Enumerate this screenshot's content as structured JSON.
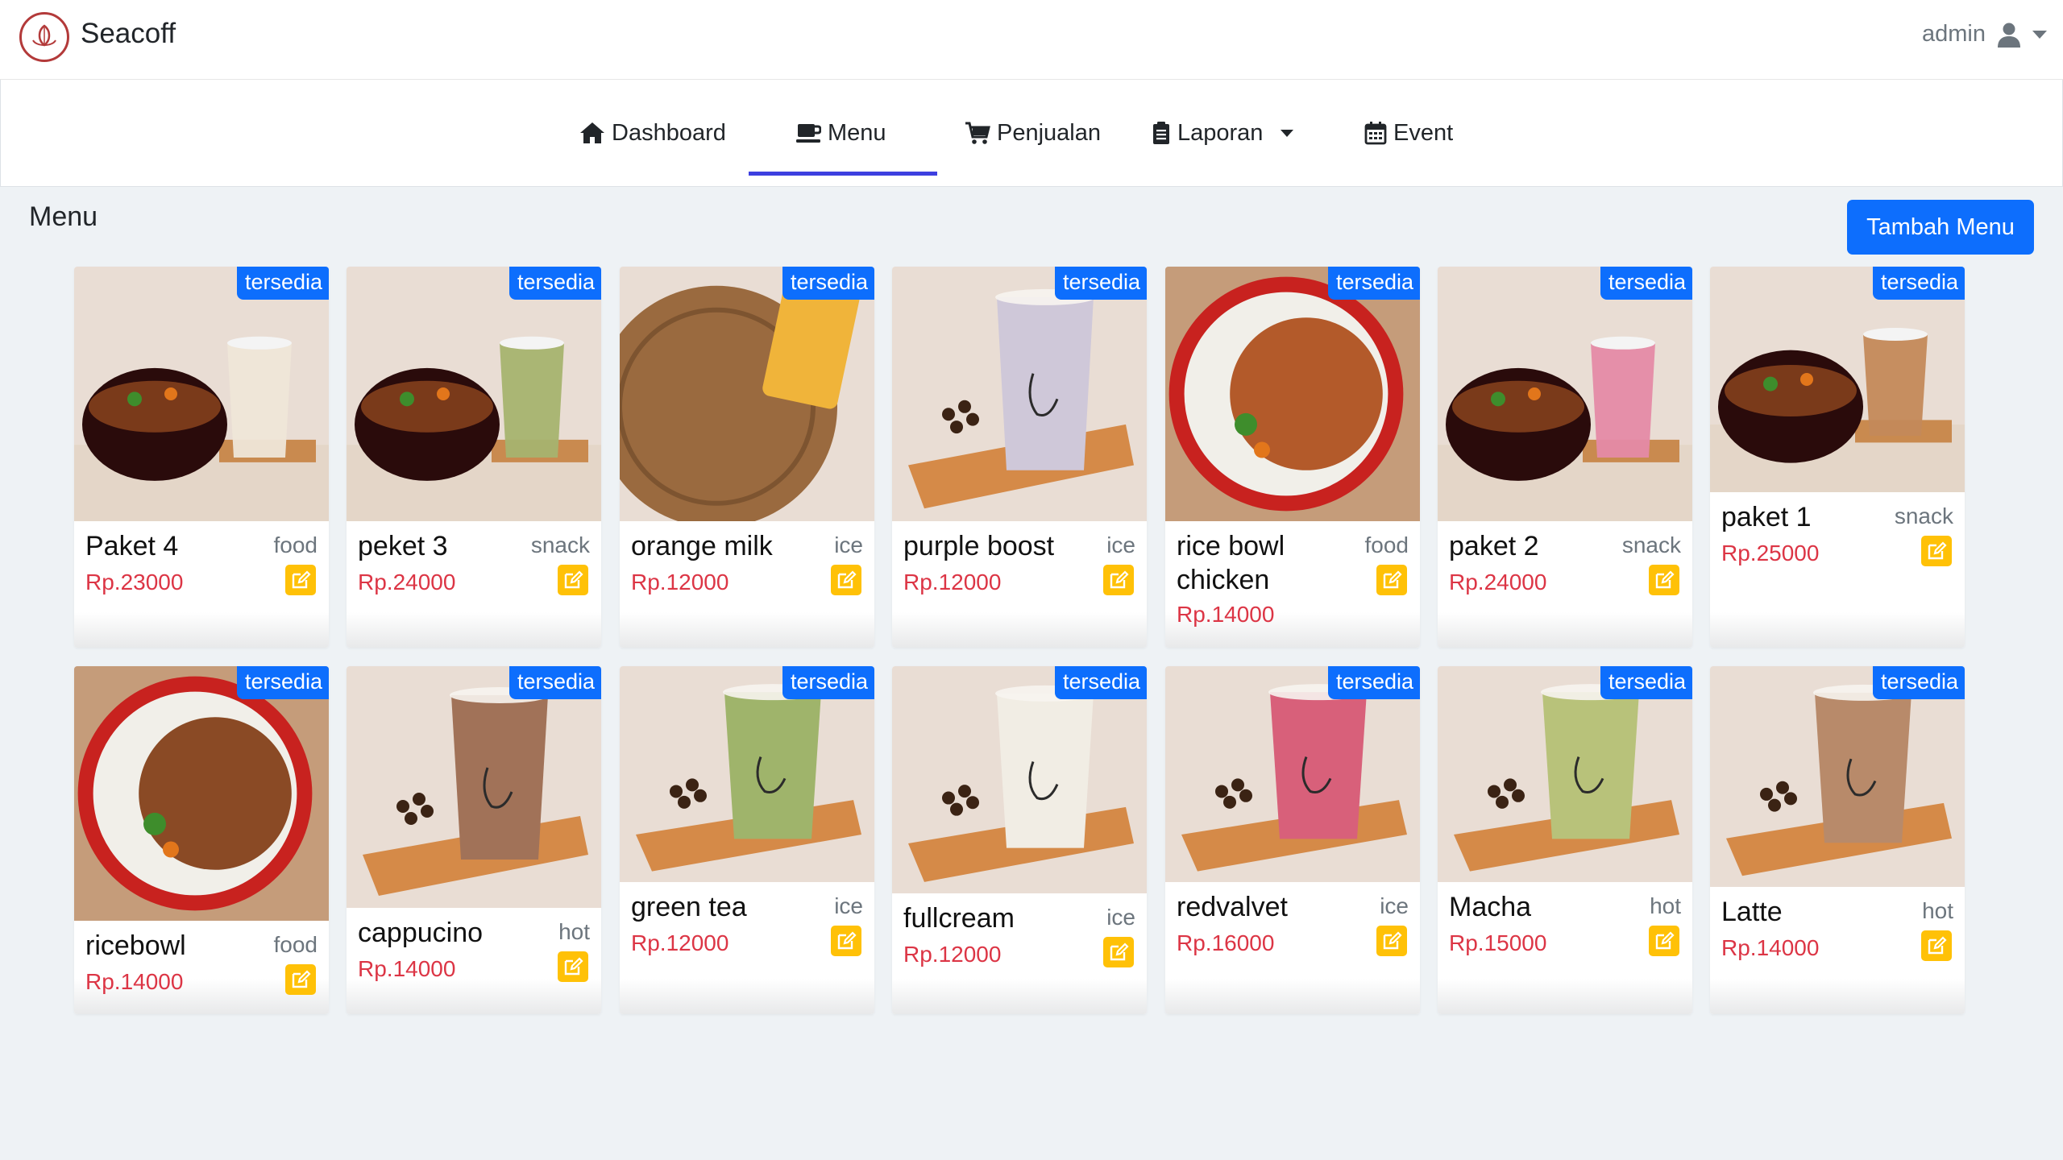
{
  "app": {
    "brand": "Seacoff",
    "user": "admin"
  },
  "nav": {
    "dashboard": "Dashboard",
    "menu": "Menu",
    "penjualan": "Penjualan",
    "laporan": "Laporan",
    "event": "Event",
    "active": "Menu"
  },
  "page": {
    "title": "Menu",
    "add_button": "Tambah Menu"
  },
  "colors": {
    "primary": "#0d6efd",
    "price": "#dc3545",
    "edit": "#ffc107",
    "active_nav": "#3d3fe0"
  },
  "items": [
    {
      "name": "Paket 4",
      "category": "food",
      "price": "Rp.23000",
      "status": "tersedia",
      "image": "rice-bowl-with-milk-drink"
    },
    {
      "name": "peket 3",
      "category": "snack",
      "price": "Rp.24000",
      "status": "tersedia",
      "image": "rice-bowl-with-green-tea"
    },
    {
      "name": "orange milk",
      "category": "ice",
      "price": "Rp.12000",
      "status": "tersedia",
      "image": "orange-drink-on-wicker"
    },
    {
      "name": "purple boost",
      "category": "ice",
      "price": "Rp.12000",
      "status": "tersedia",
      "image": "purple-drink-with-beans"
    },
    {
      "name": "rice bowl chicken",
      "category": "food",
      "price": "Rp.14000",
      "status": "tersedia",
      "image": "chicken-rice-bowl"
    },
    {
      "name": "paket 2",
      "category": "snack",
      "price": "Rp.24000",
      "status": "tersedia",
      "image": "rice-bowl-with-pink-drink"
    },
    {
      "name": "paket 1",
      "category": "snack",
      "price": "Rp.25000",
      "status": "tersedia",
      "image": "rice-bowl-with-brown-drink"
    },
    {
      "name": "ricebowl",
      "category": "food",
      "price": "Rp.14000",
      "status": "tersedia",
      "image": "rice-bowl-closeup"
    },
    {
      "name": "cappucino",
      "category": "hot",
      "price": "Rp.14000",
      "status": "tersedia",
      "image": "cappuccino-cup"
    },
    {
      "name": "green tea",
      "category": "ice",
      "price": "Rp.12000",
      "status": "tersedia",
      "image": "green-tea-cup"
    },
    {
      "name": "fullcream",
      "category": "ice",
      "price": "Rp.12000",
      "status": "tersedia",
      "image": "fullcream-cup"
    },
    {
      "name": "redvalvet",
      "category": "ice",
      "price": "Rp.16000",
      "status": "tersedia",
      "image": "red-velvet-cup"
    },
    {
      "name": "Macha",
      "category": "hot",
      "price": "Rp.15000",
      "status": "tersedia",
      "image": "matcha-cup"
    },
    {
      "name": "Latte",
      "category": "hot",
      "price": "Rp.14000",
      "status": "tersedia",
      "image": "latte-cup"
    }
  ]
}
